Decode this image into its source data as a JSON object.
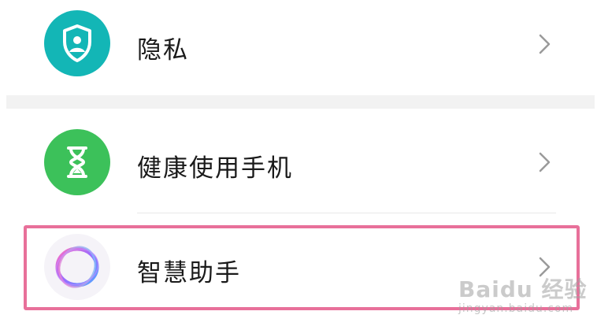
{
  "settings": {
    "items": [
      {
        "label": "隐私",
        "icon": "privacy-shield-icon",
        "icon_color": "#13b6b6"
      },
      {
        "label": "健康使用手机",
        "icon": "hourglass-icon",
        "icon_color": "#3cc15a"
      },
      {
        "label": "智慧助手",
        "icon": "smart-assistant-ring-icon",
        "icon_color": "#b06cf0"
      }
    ]
  },
  "watermark": {
    "logo": "Baidu 经验",
    "url": "jingyan.baidu.com"
  },
  "colors": {
    "highlight_border": "#e8709a",
    "separator": "#f2f2f2",
    "chevron": "#9a9a9a"
  }
}
